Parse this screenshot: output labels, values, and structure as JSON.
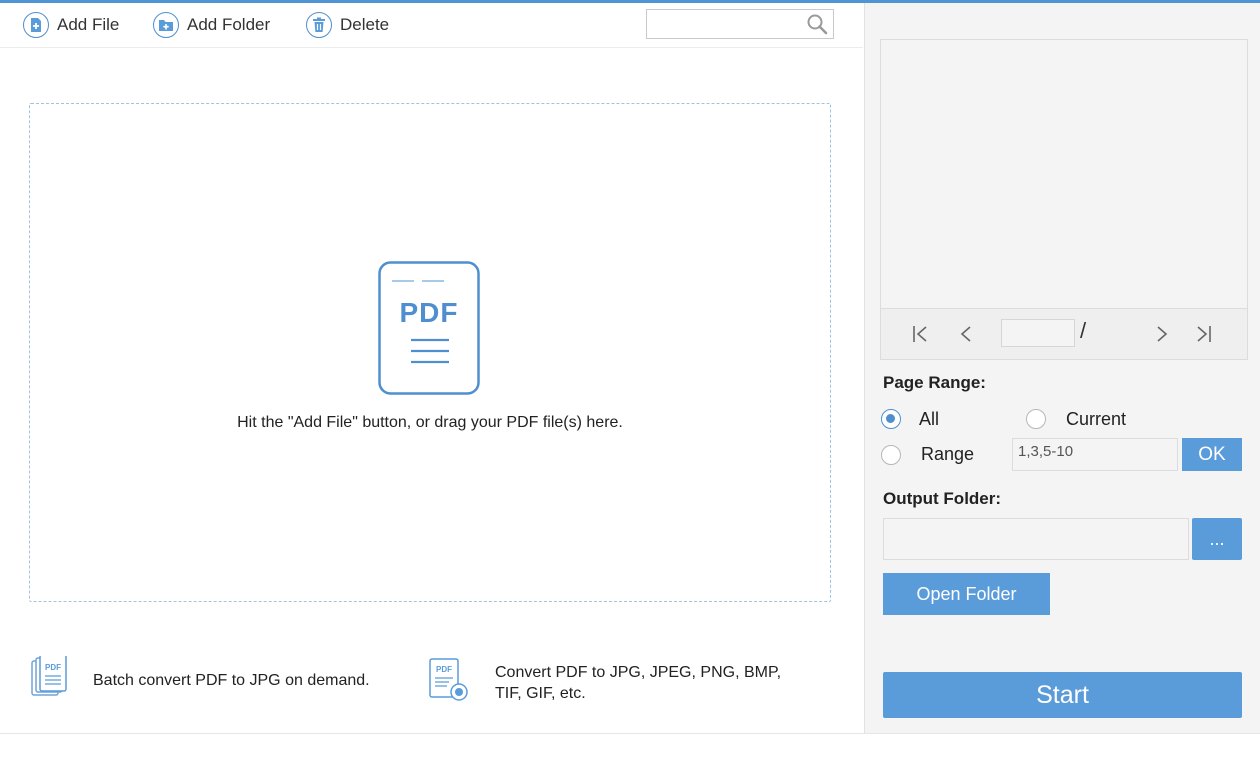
{
  "toolbar": {
    "add_file": "Add File",
    "add_folder": "Add Folder",
    "delete": "Delete",
    "search_value": ""
  },
  "dropzone": {
    "doc_label": "PDF",
    "hint": "Hit the \"Add File\" button, or drag your PDF file(s) here."
  },
  "features": [
    {
      "icon": "batch-pdf-icon",
      "text": "Batch convert PDF to JPG on demand."
    },
    {
      "icon": "convert-pdf-icon",
      "text_line1": "Convert PDF to JPG, JPEG, PNG, BMP,",
      "text_line2": "TIF, GIF, etc."
    }
  ],
  "preview": {
    "page_value": "",
    "slash": "/"
  },
  "page_range": {
    "label": "Page Range:",
    "all": "All",
    "current": "Current",
    "range": "Range",
    "selected": "All",
    "range_value": "1,3,5-10",
    "ok": "OK"
  },
  "output": {
    "label": "Output Folder:",
    "path_value": "",
    "browse": "...",
    "open_folder": "Open Folder"
  },
  "start": "Start",
  "colors": {
    "accent": "#5a9cda",
    "icon_blue": "#4f8fcf"
  }
}
